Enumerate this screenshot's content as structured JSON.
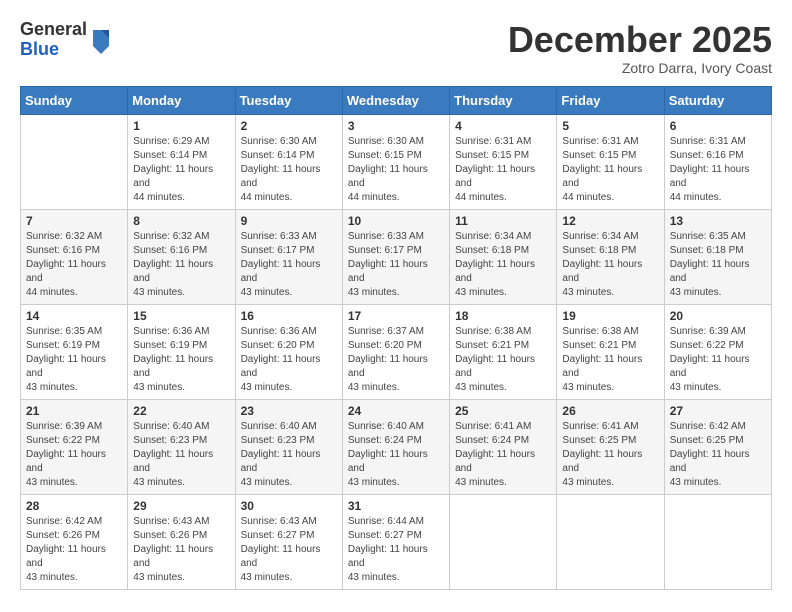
{
  "logo": {
    "general": "General",
    "blue": "Blue"
  },
  "header": {
    "month": "December 2025",
    "location": "Zotro Darra, Ivory Coast"
  },
  "weekdays": [
    "Sunday",
    "Monday",
    "Tuesday",
    "Wednesday",
    "Thursday",
    "Friday",
    "Saturday"
  ],
  "weeks": [
    [
      {
        "day": "",
        "sunrise": "",
        "sunset": "",
        "daylight": ""
      },
      {
        "day": "1",
        "sunrise": "Sunrise: 6:29 AM",
        "sunset": "Sunset: 6:14 PM",
        "daylight": "Daylight: 11 hours and 44 minutes."
      },
      {
        "day": "2",
        "sunrise": "Sunrise: 6:30 AM",
        "sunset": "Sunset: 6:14 PM",
        "daylight": "Daylight: 11 hours and 44 minutes."
      },
      {
        "day": "3",
        "sunrise": "Sunrise: 6:30 AM",
        "sunset": "Sunset: 6:15 PM",
        "daylight": "Daylight: 11 hours and 44 minutes."
      },
      {
        "day": "4",
        "sunrise": "Sunrise: 6:31 AM",
        "sunset": "Sunset: 6:15 PM",
        "daylight": "Daylight: 11 hours and 44 minutes."
      },
      {
        "day": "5",
        "sunrise": "Sunrise: 6:31 AM",
        "sunset": "Sunset: 6:15 PM",
        "daylight": "Daylight: 11 hours and 44 minutes."
      },
      {
        "day": "6",
        "sunrise": "Sunrise: 6:31 AM",
        "sunset": "Sunset: 6:16 PM",
        "daylight": "Daylight: 11 hours and 44 minutes."
      }
    ],
    [
      {
        "day": "7",
        "sunrise": "Sunrise: 6:32 AM",
        "sunset": "Sunset: 6:16 PM",
        "daylight": "Daylight: 11 hours and 44 minutes."
      },
      {
        "day": "8",
        "sunrise": "Sunrise: 6:32 AM",
        "sunset": "Sunset: 6:16 PM",
        "daylight": "Daylight: 11 hours and 43 minutes."
      },
      {
        "day": "9",
        "sunrise": "Sunrise: 6:33 AM",
        "sunset": "Sunset: 6:17 PM",
        "daylight": "Daylight: 11 hours and 43 minutes."
      },
      {
        "day": "10",
        "sunrise": "Sunrise: 6:33 AM",
        "sunset": "Sunset: 6:17 PM",
        "daylight": "Daylight: 11 hours and 43 minutes."
      },
      {
        "day": "11",
        "sunrise": "Sunrise: 6:34 AM",
        "sunset": "Sunset: 6:18 PM",
        "daylight": "Daylight: 11 hours and 43 minutes."
      },
      {
        "day": "12",
        "sunrise": "Sunrise: 6:34 AM",
        "sunset": "Sunset: 6:18 PM",
        "daylight": "Daylight: 11 hours and 43 minutes."
      },
      {
        "day": "13",
        "sunrise": "Sunrise: 6:35 AM",
        "sunset": "Sunset: 6:18 PM",
        "daylight": "Daylight: 11 hours and 43 minutes."
      }
    ],
    [
      {
        "day": "14",
        "sunrise": "Sunrise: 6:35 AM",
        "sunset": "Sunset: 6:19 PM",
        "daylight": "Daylight: 11 hours and 43 minutes."
      },
      {
        "day": "15",
        "sunrise": "Sunrise: 6:36 AM",
        "sunset": "Sunset: 6:19 PM",
        "daylight": "Daylight: 11 hours and 43 minutes."
      },
      {
        "day": "16",
        "sunrise": "Sunrise: 6:36 AM",
        "sunset": "Sunset: 6:20 PM",
        "daylight": "Daylight: 11 hours and 43 minutes."
      },
      {
        "day": "17",
        "sunrise": "Sunrise: 6:37 AM",
        "sunset": "Sunset: 6:20 PM",
        "daylight": "Daylight: 11 hours and 43 minutes."
      },
      {
        "day": "18",
        "sunrise": "Sunrise: 6:38 AM",
        "sunset": "Sunset: 6:21 PM",
        "daylight": "Daylight: 11 hours and 43 minutes."
      },
      {
        "day": "19",
        "sunrise": "Sunrise: 6:38 AM",
        "sunset": "Sunset: 6:21 PM",
        "daylight": "Daylight: 11 hours and 43 minutes."
      },
      {
        "day": "20",
        "sunrise": "Sunrise: 6:39 AM",
        "sunset": "Sunset: 6:22 PM",
        "daylight": "Daylight: 11 hours and 43 minutes."
      }
    ],
    [
      {
        "day": "21",
        "sunrise": "Sunrise: 6:39 AM",
        "sunset": "Sunset: 6:22 PM",
        "daylight": "Daylight: 11 hours and 43 minutes."
      },
      {
        "day": "22",
        "sunrise": "Sunrise: 6:40 AM",
        "sunset": "Sunset: 6:23 PM",
        "daylight": "Daylight: 11 hours and 43 minutes."
      },
      {
        "day": "23",
        "sunrise": "Sunrise: 6:40 AM",
        "sunset": "Sunset: 6:23 PM",
        "daylight": "Daylight: 11 hours and 43 minutes."
      },
      {
        "day": "24",
        "sunrise": "Sunrise: 6:40 AM",
        "sunset": "Sunset: 6:24 PM",
        "daylight": "Daylight: 11 hours and 43 minutes."
      },
      {
        "day": "25",
        "sunrise": "Sunrise: 6:41 AM",
        "sunset": "Sunset: 6:24 PM",
        "daylight": "Daylight: 11 hours and 43 minutes."
      },
      {
        "day": "26",
        "sunrise": "Sunrise: 6:41 AM",
        "sunset": "Sunset: 6:25 PM",
        "daylight": "Daylight: 11 hours and 43 minutes."
      },
      {
        "day": "27",
        "sunrise": "Sunrise: 6:42 AM",
        "sunset": "Sunset: 6:25 PM",
        "daylight": "Daylight: 11 hours and 43 minutes."
      }
    ],
    [
      {
        "day": "28",
        "sunrise": "Sunrise: 6:42 AM",
        "sunset": "Sunset: 6:26 PM",
        "daylight": "Daylight: 11 hours and 43 minutes."
      },
      {
        "day": "29",
        "sunrise": "Sunrise: 6:43 AM",
        "sunset": "Sunset: 6:26 PM",
        "daylight": "Daylight: 11 hours and 43 minutes."
      },
      {
        "day": "30",
        "sunrise": "Sunrise: 6:43 AM",
        "sunset": "Sunset: 6:27 PM",
        "daylight": "Daylight: 11 hours and 43 minutes."
      },
      {
        "day": "31",
        "sunrise": "Sunrise: 6:44 AM",
        "sunset": "Sunset: 6:27 PM",
        "daylight": "Daylight: 11 hours and 43 minutes."
      },
      {
        "day": "",
        "sunrise": "",
        "sunset": "",
        "daylight": ""
      },
      {
        "day": "",
        "sunrise": "",
        "sunset": "",
        "daylight": ""
      },
      {
        "day": "",
        "sunrise": "",
        "sunset": "",
        "daylight": ""
      }
    ]
  ]
}
